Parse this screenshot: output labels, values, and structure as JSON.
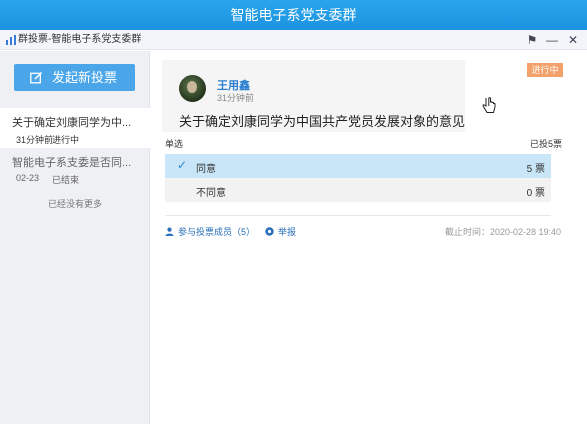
{
  "window": {
    "title": "智能电子系党支委群"
  },
  "toolbar": {
    "title": "群投票-智能电子系党支委群",
    "chart_icon": "bar-chart-icon",
    "buttons": {
      "pin": "⚑",
      "minimize": "—",
      "close": "✕"
    }
  },
  "sidebar": {
    "new_vote_label": "发起新投票",
    "new_vote_icon": "edit-icon",
    "items": [
      {
        "title": "关于确定刘康同学为中...",
        "time": "31分钟前",
        "status": "进行中"
      },
      {
        "title": "智能电子系支委是否同...",
        "time": "02-23",
        "status": "已结束"
      }
    ],
    "no_more": "已经没有更多"
  },
  "vote": {
    "author": "王用鑫",
    "time": "31分钟前",
    "title": "关于确定刘康同学为中国共产党员发展对象的意见",
    "status_tag": "进行中",
    "type_label": "单选",
    "count_label": "已投5票",
    "options": [
      {
        "label": "同意",
        "votes": "5 票",
        "selected": true
      },
      {
        "label": "不同意",
        "votes": "0 票",
        "selected": false
      }
    ],
    "members_link": "参与投票成员（5）",
    "report_link": "举报",
    "deadline": "截止时间：2020-02-28 19:40"
  },
  "colors": {
    "titlebar": "#1c93e0",
    "accent": "#4aa6e8",
    "selected_option": "#c9e6f8",
    "status_tag": "#f3a16b",
    "link": "#2a6fb8"
  }
}
